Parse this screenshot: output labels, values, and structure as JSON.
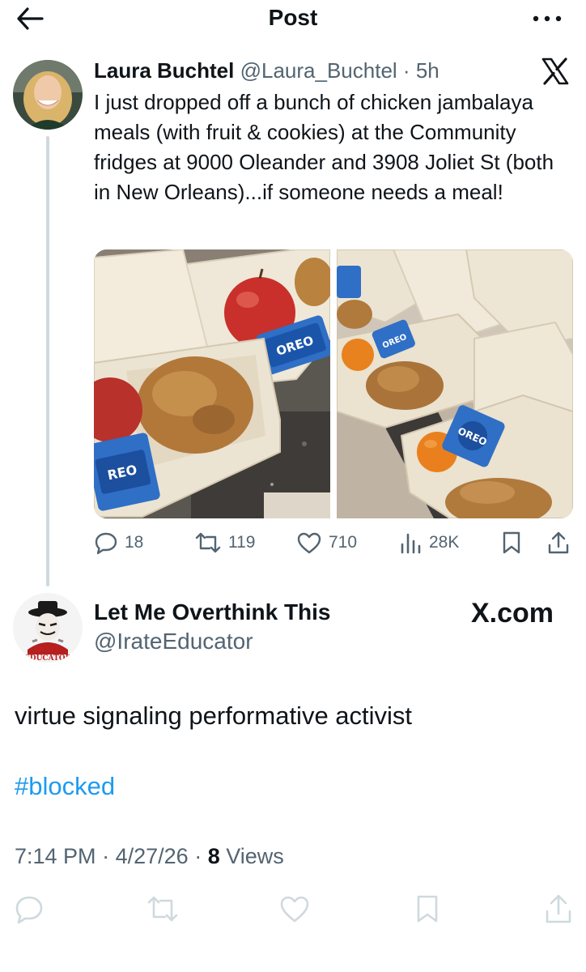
{
  "header": {
    "title": "Post",
    "back_icon": "arrow-left-icon",
    "more_icon": "more-horizontal-icon"
  },
  "quoted_post": {
    "author_name": "Laura Buchtel",
    "author_handle": "@Laura_Buchtel",
    "separator": "·",
    "age": "5h",
    "text": "I just dropped off a bunch of chicken jambalaya meals (with fruit & cookies) at the Community fridges at 9000 Oleander and 3908 Joliet St (both in New Orleans)...if someone needs a meal!",
    "brand_icon": "x-logo-icon",
    "photos": [
      {
        "description": "takeout containers with apple, oreos, jambalaya",
        "oreo_label": "OREO"
      },
      {
        "description": "containers with oranges, oreos, jambalaya",
        "oreo_label": "OREO"
      }
    ],
    "stats": {
      "replies": "18",
      "reposts": "119",
      "likes": "710",
      "views": "28K"
    }
  },
  "post": {
    "author_name": "Let Me Overthink This",
    "author_handle": "@IrateEducator",
    "avatar_text": "THE IRATE EDUCATOR",
    "watermark": "X.com",
    "text": "virtue signaling performative activist",
    "hashtag": "#blocked",
    "time": "7:14 PM",
    "date": "4/27/26",
    "views_count": "8",
    "views_label": "Views",
    "meta_separator": "·"
  },
  "colors": {
    "text": "#0f1419",
    "secondary": "#536471",
    "link": "#1d9bf0",
    "divider": "#cfd9de"
  }
}
